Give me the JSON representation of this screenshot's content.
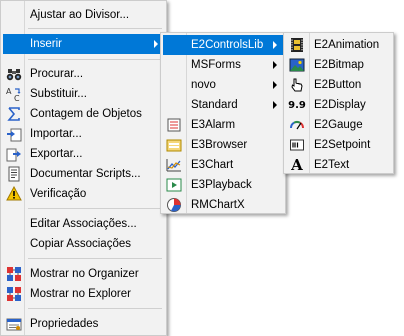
{
  "main_menu": {
    "items": [
      {
        "label": "Ajustar ao Divisor..."
      },
      {
        "label": "Inserir"
      },
      {
        "label": "Procurar..."
      },
      {
        "label": "Substituir..."
      },
      {
        "label": "Contagem de Objetos"
      },
      {
        "label": "Importar..."
      },
      {
        "label": "Exportar..."
      },
      {
        "label": "Documentar Scripts..."
      },
      {
        "label": "Verificação"
      },
      {
        "label": "Editar Associações..."
      },
      {
        "label": "Copiar Associações"
      },
      {
        "label": "Mostrar no Organizer"
      },
      {
        "label": "Mostrar no Explorer"
      },
      {
        "label": "Propriedades"
      }
    ]
  },
  "insert_submenu": {
    "items": [
      {
        "label": "E2ControlsLib"
      },
      {
        "label": "MSForms"
      },
      {
        "label": "novo"
      },
      {
        "label": "Standard"
      },
      {
        "label": "E3Alarm"
      },
      {
        "label": "E3Browser"
      },
      {
        "label": "E3Chart"
      },
      {
        "label": "E3Playback"
      },
      {
        "label": "RMChartX"
      }
    ]
  },
  "e2controls_submenu": {
    "items": [
      {
        "label": "E2Animation"
      },
      {
        "label": "E2Bitmap"
      },
      {
        "label": "E2Button"
      },
      {
        "label": "E2Display"
      },
      {
        "label": "E2Gauge"
      },
      {
        "label": "E2Setpoint"
      },
      {
        "label": "E2Text"
      }
    ]
  },
  "icons": {
    "e2display_glyph": "9.9",
    "e2text_glyph": "A"
  },
  "colors": {
    "highlight": "#0078d7",
    "menu_bg": "#f2f2f2"
  }
}
